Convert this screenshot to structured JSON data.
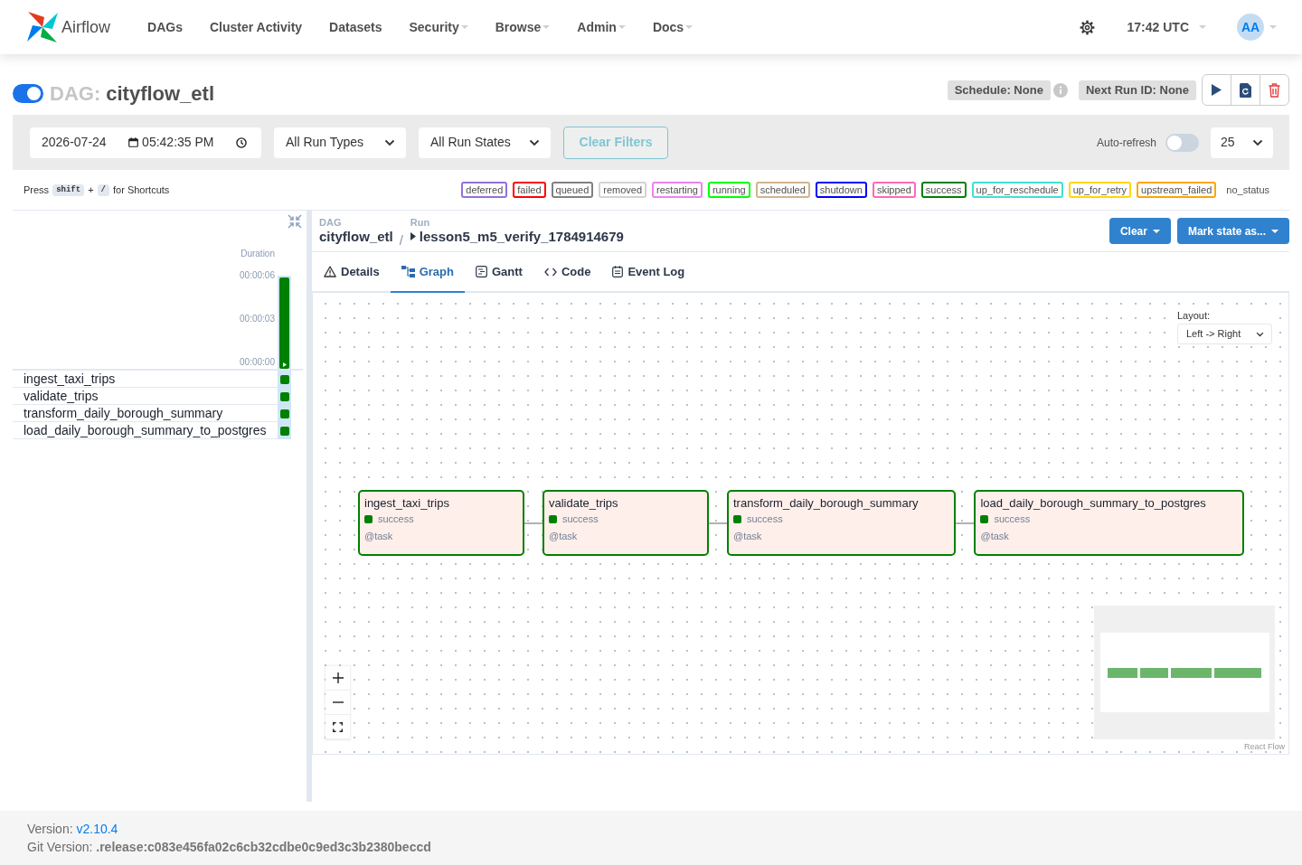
{
  "navbar": {
    "brand": "Airflow",
    "items": [
      {
        "label": "DAGs",
        "dropdown": false
      },
      {
        "label": "Cluster Activity",
        "dropdown": false
      },
      {
        "label": "Datasets",
        "dropdown": false
      },
      {
        "label": "Security",
        "dropdown": true
      },
      {
        "label": "Browse",
        "dropdown": true
      },
      {
        "label": "Admin",
        "dropdown": true
      },
      {
        "label": "Docs",
        "dropdown": true
      }
    ],
    "clock": "17:42 UTC",
    "avatar": "AA"
  },
  "dag": {
    "active": true,
    "label": "DAG:",
    "name": "cityflow_etl",
    "schedule": "Schedule: None",
    "next_run": "Next Run ID: None"
  },
  "filters": {
    "date": "2026-07-24",
    "time": "05:42:35 PM",
    "run_type": "All Run Types",
    "run_state": "All Run States",
    "clear": {
      "label": "Clear Filters",
      "disabled": true
    },
    "auto_refresh": {
      "label": "Auto-refresh",
      "on": false
    },
    "page_size": "25"
  },
  "shortcuts": {
    "prefix": "Press",
    "keys": [
      "shift",
      "/"
    ],
    "joiner": "+",
    "suffix": "for Shortcuts"
  },
  "legend": [
    {
      "label": "deferred",
      "color": "#9370db"
    },
    {
      "label": "failed",
      "color": "#ff0000"
    },
    {
      "label": "queued",
      "color": "#808080"
    },
    {
      "label": "removed",
      "color": "#d3d3d3"
    },
    {
      "label": "restarting",
      "color": "#ee82ee"
    },
    {
      "label": "running",
      "color": "#00ff00"
    },
    {
      "label": "scheduled",
      "color": "#d2b48c"
    },
    {
      "label": "shutdown",
      "color": "#0000ff"
    },
    {
      "label": "skipped",
      "color": "#ff69b4"
    },
    {
      "label": "success",
      "color": "#008000"
    },
    {
      "label": "up_for_reschedule",
      "color": "#40e0d0"
    },
    {
      "label": "up_for_retry",
      "color": "#ffd700"
    },
    {
      "label": "upstream_failed",
      "color": "#ffa500"
    },
    {
      "label": "no_status"
    }
  ],
  "grid": {
    "duration_label": "Duration",
    "ticks": [
      "00:00:06",
      "00:00:03",
      "00:00:00"
    ],
    "runs": [
      {
        "level": 1,
        "selected": true,
        "color": "#008000"
      }
    ],
    "tasks": [
      {
        "name": "ingest_taxi_trips",
        "color": "#008000"
      },
      {
        "name": "validate_trips",
        "color": "#008000"
      },
      {
        "name": "transform_daily_borough_summary",
        "color": "#008000"
      },
      {
        "name": "load_daily_borough_summary_to_postgres",
        "color": "#008000"
      }
    ]
  },
  "breadcrumb": {
    "dag_label": "DAG",
    "dag": "cityflow_etl",
    "separator": "/",
    "run_label": "Run",
    "run": "lesson5_m5_verify_1784914679"
  },
  "actions": [
    "Clear",
    "Mark state as..."
  ],
  "tabs": [
    {
      "label": "Details",
      "kind": "details",
      "selected": false
    },
    {
      "label": "Graph",
      "kind": "graph",
      "selected": true
    },
    {
      "label": "Gantt",
      "kind": "gantt",
      "selected": false
    },
    {
      "label": "Code",
      "kind": "code",
      "selected": false
    },
    {
      "label": "Event Log",
      "kind": "log",
      "selected": false
    }
  ],
  "graph": {
    "layout_label": "Layout:",
    "layout": "Left -> Right",
    "nodes": [
      {
        "name": "ingest_taxi_trips",
        "state": "success",
        "operator": "@task",
        "color": "#008000"
      },
      {
        "name": "validate_trips",
        "state": "success",
        "operator": "@task",
        "color": "#008000"
      },
      {
        "name": "transform_daily_borough_summary",
        "state": "success",
        "operator": "@task",
        "color": "#008000"
      },
      {
        "name": "load_daily_borough_summary_to_postgres",
        "state": "success",
        "operator": "@task",
        "color": "#008000"
      }
    ],
    "attribution": "React Flow"
  },
  "footer": {
    "version_label": "Version:",
    "version": "v2.10.4",
    "git_label": "Git Version:",
    "git": ".release:c083e456fa02c6cb32cdbe0c9ed3c3b2380beccd"
  }
}
